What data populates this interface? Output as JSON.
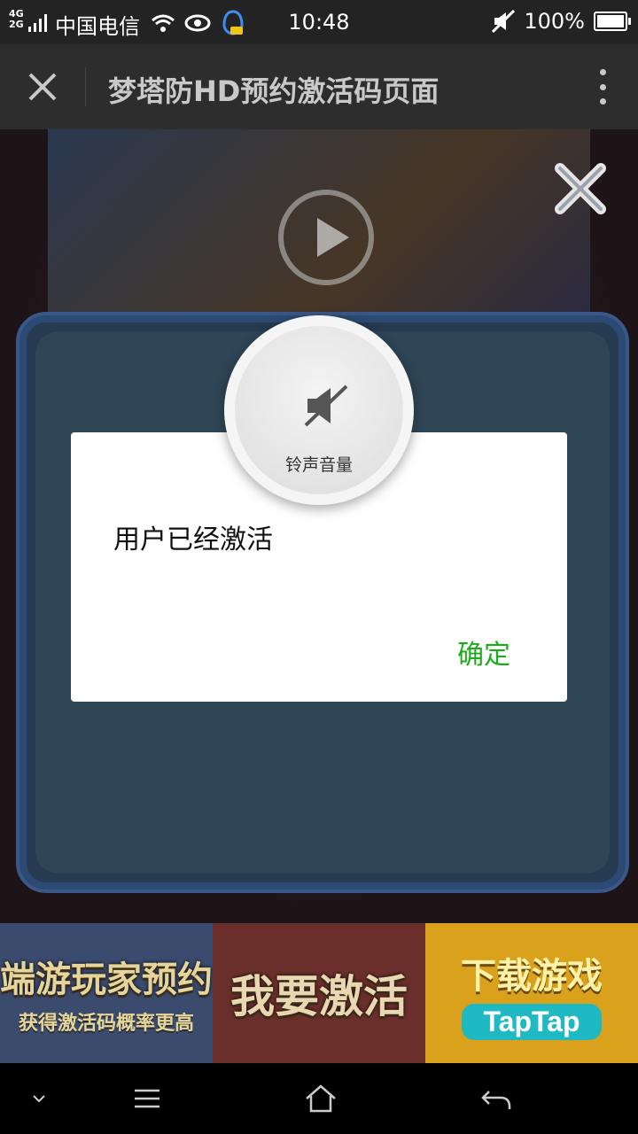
{
  "status_bar": {
    "network_top": "4G",
    "network_bottom": "2G",
    "carrier": "中国电信",
    "time": "10:48",
    "battery": "100%"
  },
  "title_bar": {
    "title": "梦塔防HD预约激活码页面"
  },
  "dialog": {
    "message": "用户已经激活",
    "confirm": "确定"
  },
  "volume_overlay": {
    "label": "铃声音量"
  },
  "banners": [
    {
      "main": "端游玩家预约",
      "sub": "获得激活码概率更高"
    },
    {
      "main": "我要激活"
    },
    {
      "main": "下载游戏",
      "badge": "TapTap"
    }
  ],
  "colors": {
    "accent_green": "#1aad19",
    "titlebar_bg": "#2d2d2d",
    "taptap": "#1fb9c3"
  }
}
